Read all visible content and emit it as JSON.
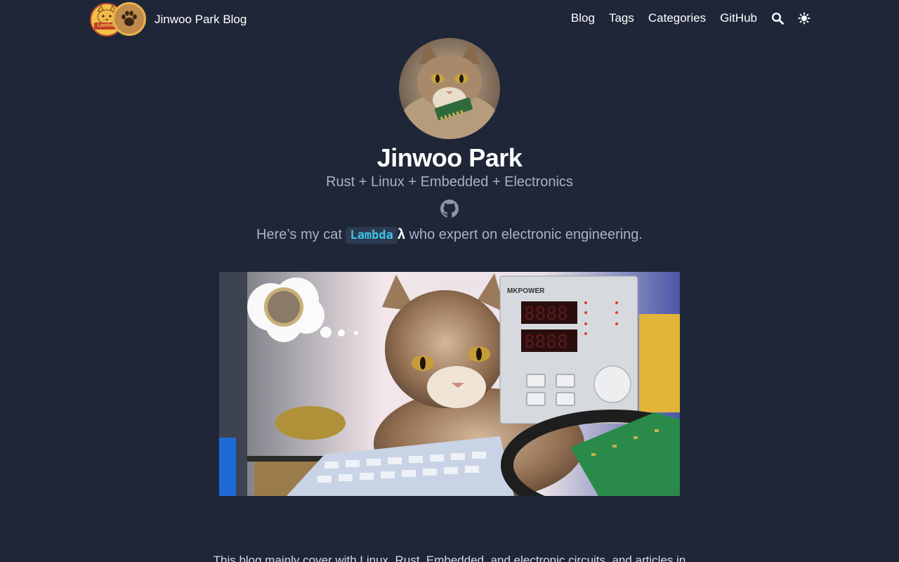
{
  "header": {
    "brand_title": "Jinwoo Park Blog",
    "logo_label": "Lambda EE",
    "nav": [
      {
        "label": "Blog"
      },
      {
        "label": "Tags"
      },
      {
        "label": "Categories"
      },
      {
        "label": "GitHub"
      }
    ],
    "search_icon": "search-icon",
    "theme_icon": "sun-icon"
  },
  "profile": {
    "name": "Jinwoo Park",
    "tagline": "Rust + Linux + Embedded + Electronics",
    "social_icon": "github-icon"
  },
  "intro": {
    "prefix": "Here’s my cat ",
    "cat_name": "Lambda",
    "lambda_symbol": "λ",
    "suffix": " who expert on electronic engineering."
  },
  "hero": {
    "power_supply_brand": "MKPOWER"
  },
  "content": {
    "description": "This blog mainly cover with Linux, Rust, Embedded, and electronic circuits, and articles in"
  },
  "colors": {
    "background": "#1e2638",
    "text_muted": "#a9b2c6",
    "code_accent": "#3fc4e8"
  }
}
